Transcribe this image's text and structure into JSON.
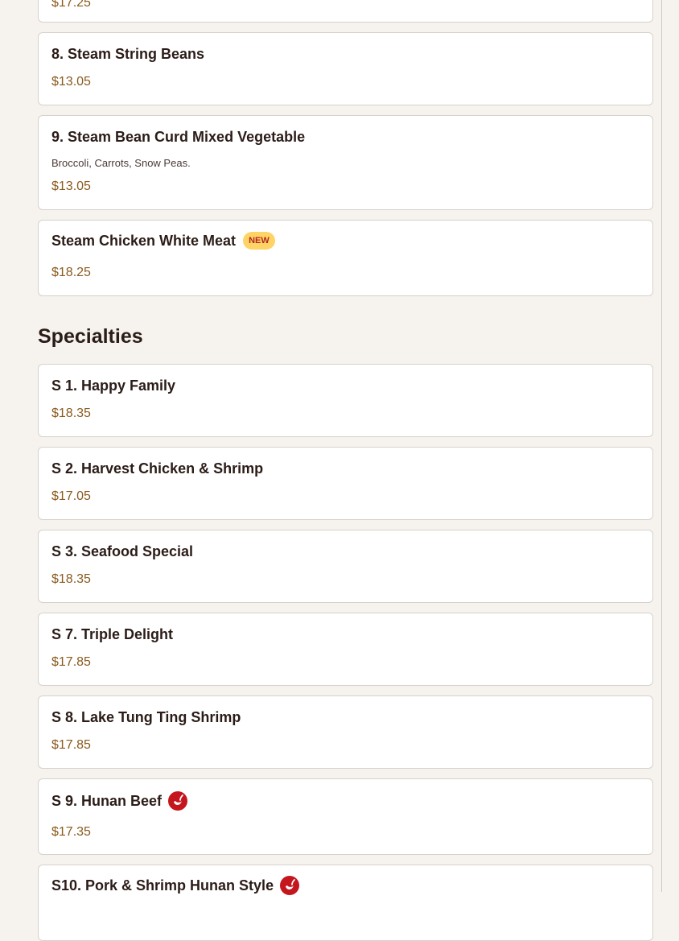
{
  "colors": {
    "background": "#f6f3ee",
    "card": "#ffffff",
    "price": "#8a5a1e",
    "badge_bg": "#ffd466",
    "badge_text": "#b3261e",
    "spicy": "#c4161c"
  },
  "top_partial_price": "$17.25",
  "vegetable_items": [
    {
      "name": "8. Steam String Beans",
      "price": "$13.05"
    },
    {
      "name": "9. Steam Bean Curd Mixed Vegetable",
      "description": "Broccoli, Carrots, Snow Peas.",
      "price": "$13.05"
    },
    {
      "name": "Steam Chicken White Meat",
      "badge": "NEW",
      "price": "$18.25"
    }
  ],
  "specialties": {
    "title": "Specialties",
    "items": [
      {
        "name": "S 1. Happy Family",
        "price": "$18.35"
      },
      {
        "name": "S 2. Harvest Chicken & Shrimp",
        "price": "$17.05"
      },
      {
        "name": "S 3. Seafood Special",
        "price": "$18.35"
      },
      {
        "name": "S 7. Triple Delight",
        "price": "$17.85"
      },
      {
        "name": "S 8. Lake Tung Ting Shrimp",
        "price": "$17.85"
      },
      {
        "name": "S 9. Hunan Beef",
        "icon": "spicy-pepper-icon",
        "price": "$17.35"
      },
      {
        "name": "S10. Pork & Shrimp Hunan Style",
        "icon": "spicy-pepper-icon"
      }
    ]
  }
}
